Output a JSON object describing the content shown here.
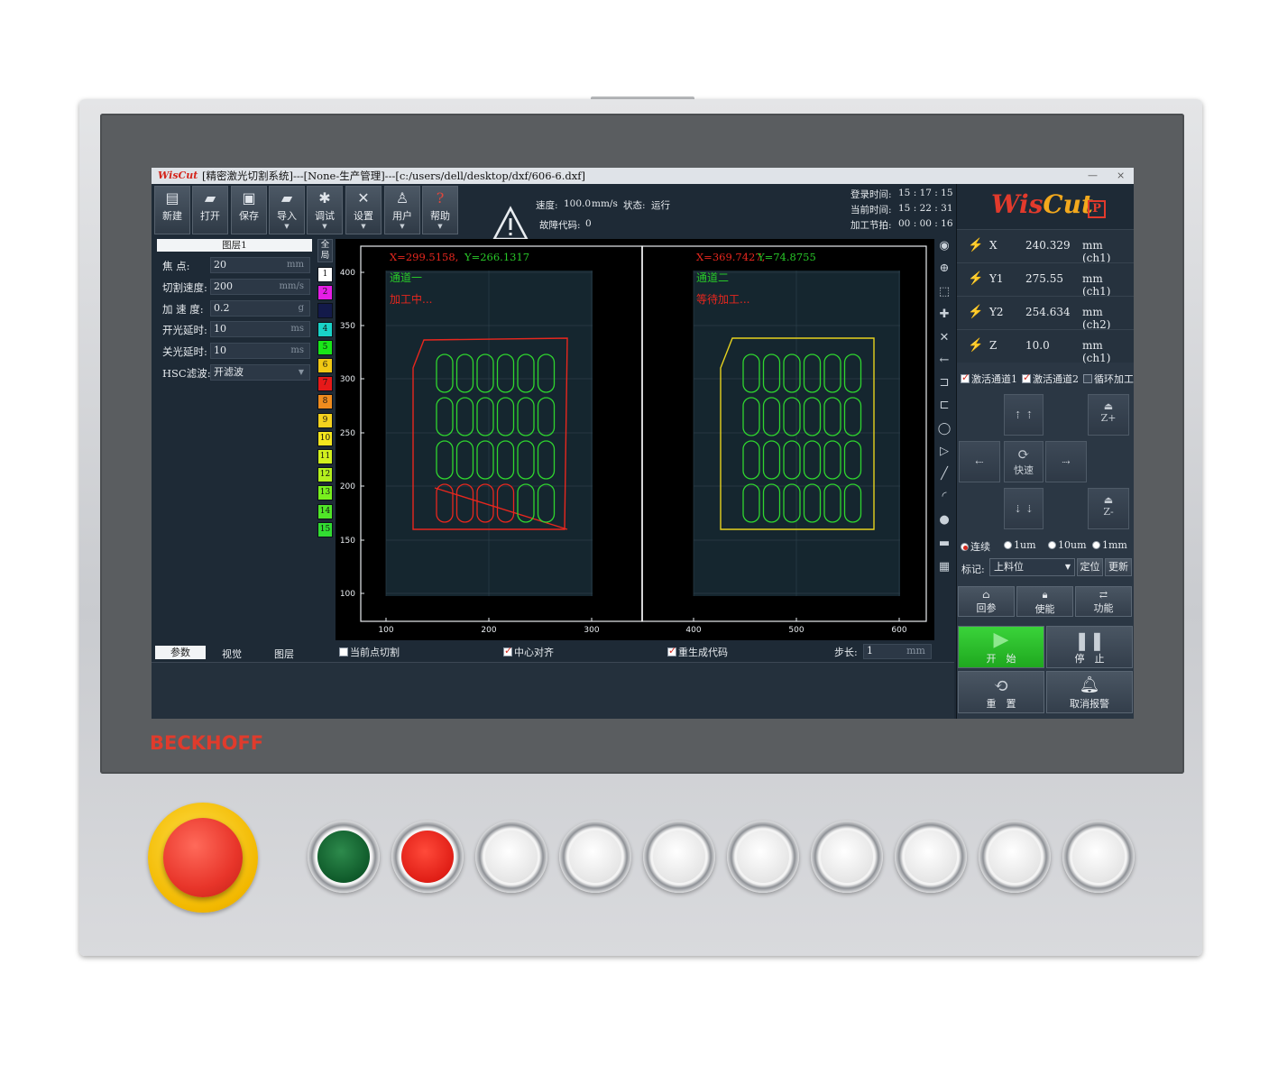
{
  "window": {
    "logo": "WisCut",
    "title": "[精密激光切割系统]---[None-生产管理]---[c:/users/dell/desktop/dxf/606-6.dxf]",
    "minimize": "—",
    "close": "×"
  },
  "toolbar": [
    {
      "label": "新建",
      "icon": "new-file-icon"
    },
    {
      "label": "打开",
      "icon": "open-folder-icon"
    },
    {
      "label": "保存",
      "icon": "save-icon"
    },
    {
      "label": "导入",
      "icon": "import-icon"
    },
    {
      "label": "调试",
      "icon": "bug-icon"
    },
    {
      "label": "设置",
      "icon": "tools-icon"
    },
    {
      "label": "用户",
      "icon": "user-icon"
    },
    {
      "label": "帮助",
      "icon": "help-icon"
    }
  ],
  "status": {
    "speed_label": "速度:",
    "speed_value": "100.0",
    "speed_unit": "mm/s",
    "state_label": "状态:",
    "state_value": "运行",
    "fault_label": "故障代码:",
    "fault_value": "0",
    "login_label": "登录时间:",
    "login_value": "15 : 17 : 15",
    "current_label": "当前时间:",
    "current_value": "15 : 22 : 31",
    "cycle_label": "加工节拍:",
    "cycle_value": "00 : 00 : 16"
  },
  "params": {
    "layer_title": "图层1",
    "rows": [
      {
        "label": "焦    点:",
        "value": "20",
        "unit": "mm"
      },
      {
        "label": "切割速度:",
        "value": "200",
        "unit": "mm/s"
      },
      {
        "label": "加 速 度:",
        "value": "0.2",
        "unit": "g"
      },
      {
        "label": "开光延时:",
        "value": "10",
        "unit": "ms"
      },
      {
        "label": "关光延时:",
        "value": "10",
        "unit": "ms"
      },
      {
        "label": "HSC滤波:",
        "value": "开滤波",
        "unit": ""
      }
    ]
  },
  "layers": {
    "all_label": "全局",
    "items": [
      {
        "n": "1",
        "color": "#ffffff"
      },
      {
        "n": "2",
        "color": "#e51ee5"
      },
      {
        "n": "",
        "color": "#131a4a"
      },
      {
        "n": "4",
        "color": "#19d2c8"
      },
      {
        "n": "5",
        "color": "#19e619"
      },
      {
        "n": "6",
        "color": "#f0c814"
      },
      {
        "n": "7",
        "color": "#e61919"
      },
      {
        "n": "8",
        "color": "#f08c1e"
      },
      {
        "n": "9",
        "color": "#f5d21e"
      },
      {
        "n": "10",
        "color": "#f5e61e"
      },
      {
        "n": "11",
        "color": "#d2f01e"
      },
      {
        "n": "12",
        "color": "#b4f01e"
      },
      {
        "n": "13",
        "color": "#78f01e"
      },
      {
        "n": "14",
        "color": "#50e628"
      },
      {
        "n": "15",
        "color": "#32dc32"
      }
    ]
  },
  "plot_left": {
    "coord": "X=299.5158,",
    "coord_y": "Y=266.1317",
    "channel": "通道一",
    "state": "加工中...",
    "x_ticks": [
      "100",
      "200",
      "300"
    ],
    "y_ticks": [
      "400",
      "350",
      "300",
      "250",
      "200",
      "150",
      "100"
    ]
  },
  "plot_right": {
    "coord": "X=369.7427,",
    "coord_y": "Y=74.8755",
    "channel": "通道二",
    "state": "等待加工...",
    "x_ticks": [
      "400",
      "500",
      "600"
    ]
  },
  "bottom": {
    "tabs": [
      "参数",
      "视觉",
      "图层"
    ],
    "opt_point_cut": "当前点切割",
    "opt_center_align": "中心对齐",
    "opt_regen_code": "重生成代码",
    "step_label": "步长:",
    "step_value": "1",
    "step_unit": "mm"
  },
  "axes": [
    {
      "name": "X",
      "value": "240.329",
      "unit": "mm (ch1)"
    },
    {
      "name": "Y1",
      "value": "275.55",
      "unit": "mm (ch1)"
    },
    {
      "name": "Y2",
      "value": "254.634",
      "unit": "mm (ch2)"
    },
    {
      "name": "Z",
      "value": "10.0",
      "unit": "mm (ch1)"
    }
  ],
  "channels": {
    "ch1": "激活通道1",
    "ch2": "激活通道2",
    "loop": "循环加工"
  },
  "jog": {
    "fast": "快速",
    "zplus": "Z+",
    "zminus": "Z-"
  },
  "step_modes": [
    "连续",
    "1um",
    "10um",
    "1mm"
  ],
  "mark": {
    "label": "标记:",
    "value": "上料位",
    "locate": "定位",
    "update": "更新"
  },
  "functions": {
    "home": "回参",
    "enable": "使能",
    "func": "功能",
    "start": "开　始",
    "stop": "停　止",
    "reset": "重　置",
    "cancel_alarm": "取消报警"
  },
  "hardware": {
    "brand": "BECKHOFF"
  }
}
